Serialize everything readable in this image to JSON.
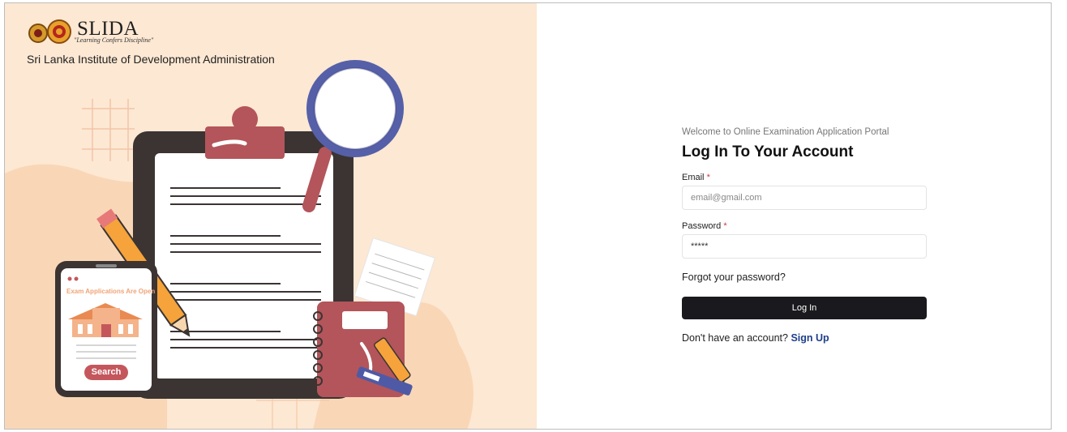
{
  "brand": {
    "name": "SLIDA",
    "tagline": "\"Learning Confers Discipline\"",
    "institute": "Sri Lanka Institute of Development Administration"
  },
  "illustration": {
    "phone_banner": "Exam Applications Are Open",
    "phone_search": "Search"
  },
  "form": {
    "welcome": "Welcome to Online Examination Application Portal",
    "title": "Log In To Your Account",
    "email_label": "Email",
    "email_placeholder": "email@gmail.com",
    "password_label": "Password",
    "password_value": "*****",
    "required_mark": "*",
    "forgot_password": "Forgot your password?",
    "login_button": "Log In",
    "signup_prompt": "Don't have an account?",
    "signup_link": "Sign Up"
  },
  "colors": {
    "left_bg": "#fde8d3",
    "primary_button": "#1a1a1e",
    "link": "#1f3f8a",
    "required": "#d23a3a"
  }
}
